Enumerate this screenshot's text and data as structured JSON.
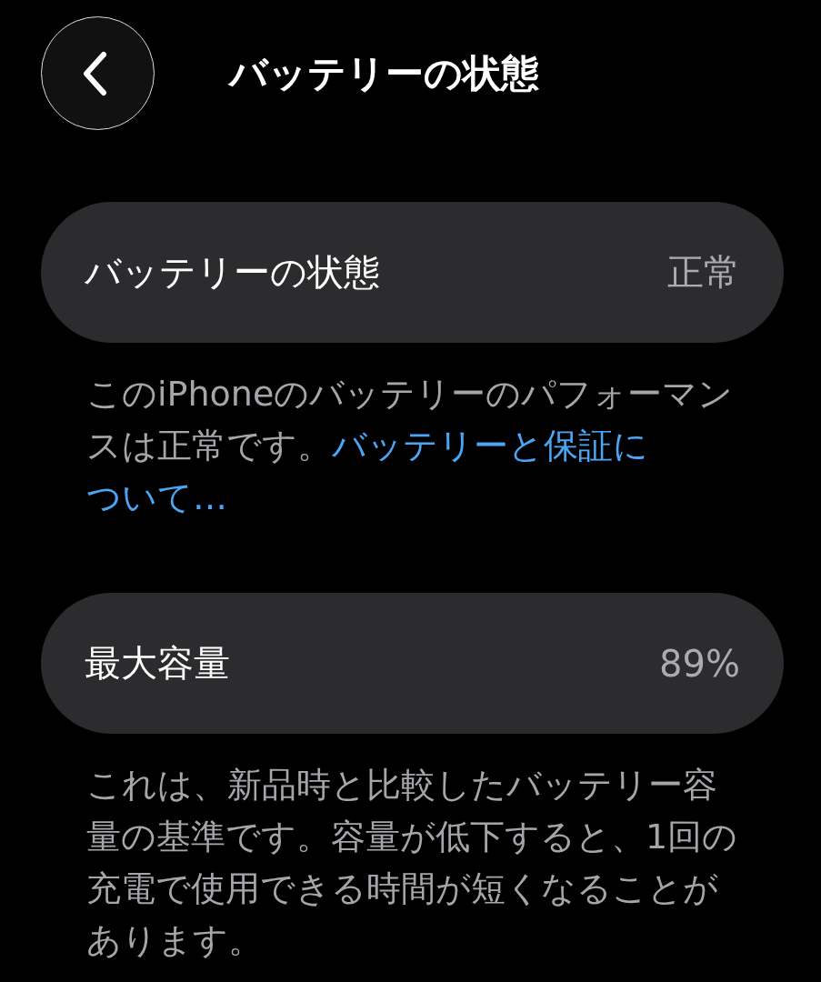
{
  "nav": {
    "title": "バッテリーの状態"
  },
  "sections": [
    {
      "row": {
        "label": "バッテリーの状態",
        "value": "正常"
      },
      "footer": {
        "text": "このiPhoneのバッテリーのパフォーマンスは正常です。",
        "link_lines": [
          "バッテリーと保証に",
          "ついて…"
        ]
      }
    },
    {
      "row": {
        "label": "最大容量",
        "value": "89%"
      },
      "footer": {
        "text": "これは、新品時と比較したバッテリー容量の基準です。容量が低下すると、1回の充電で使用できる時間が短くなることがあります。"
      }
    }
  ]
}
